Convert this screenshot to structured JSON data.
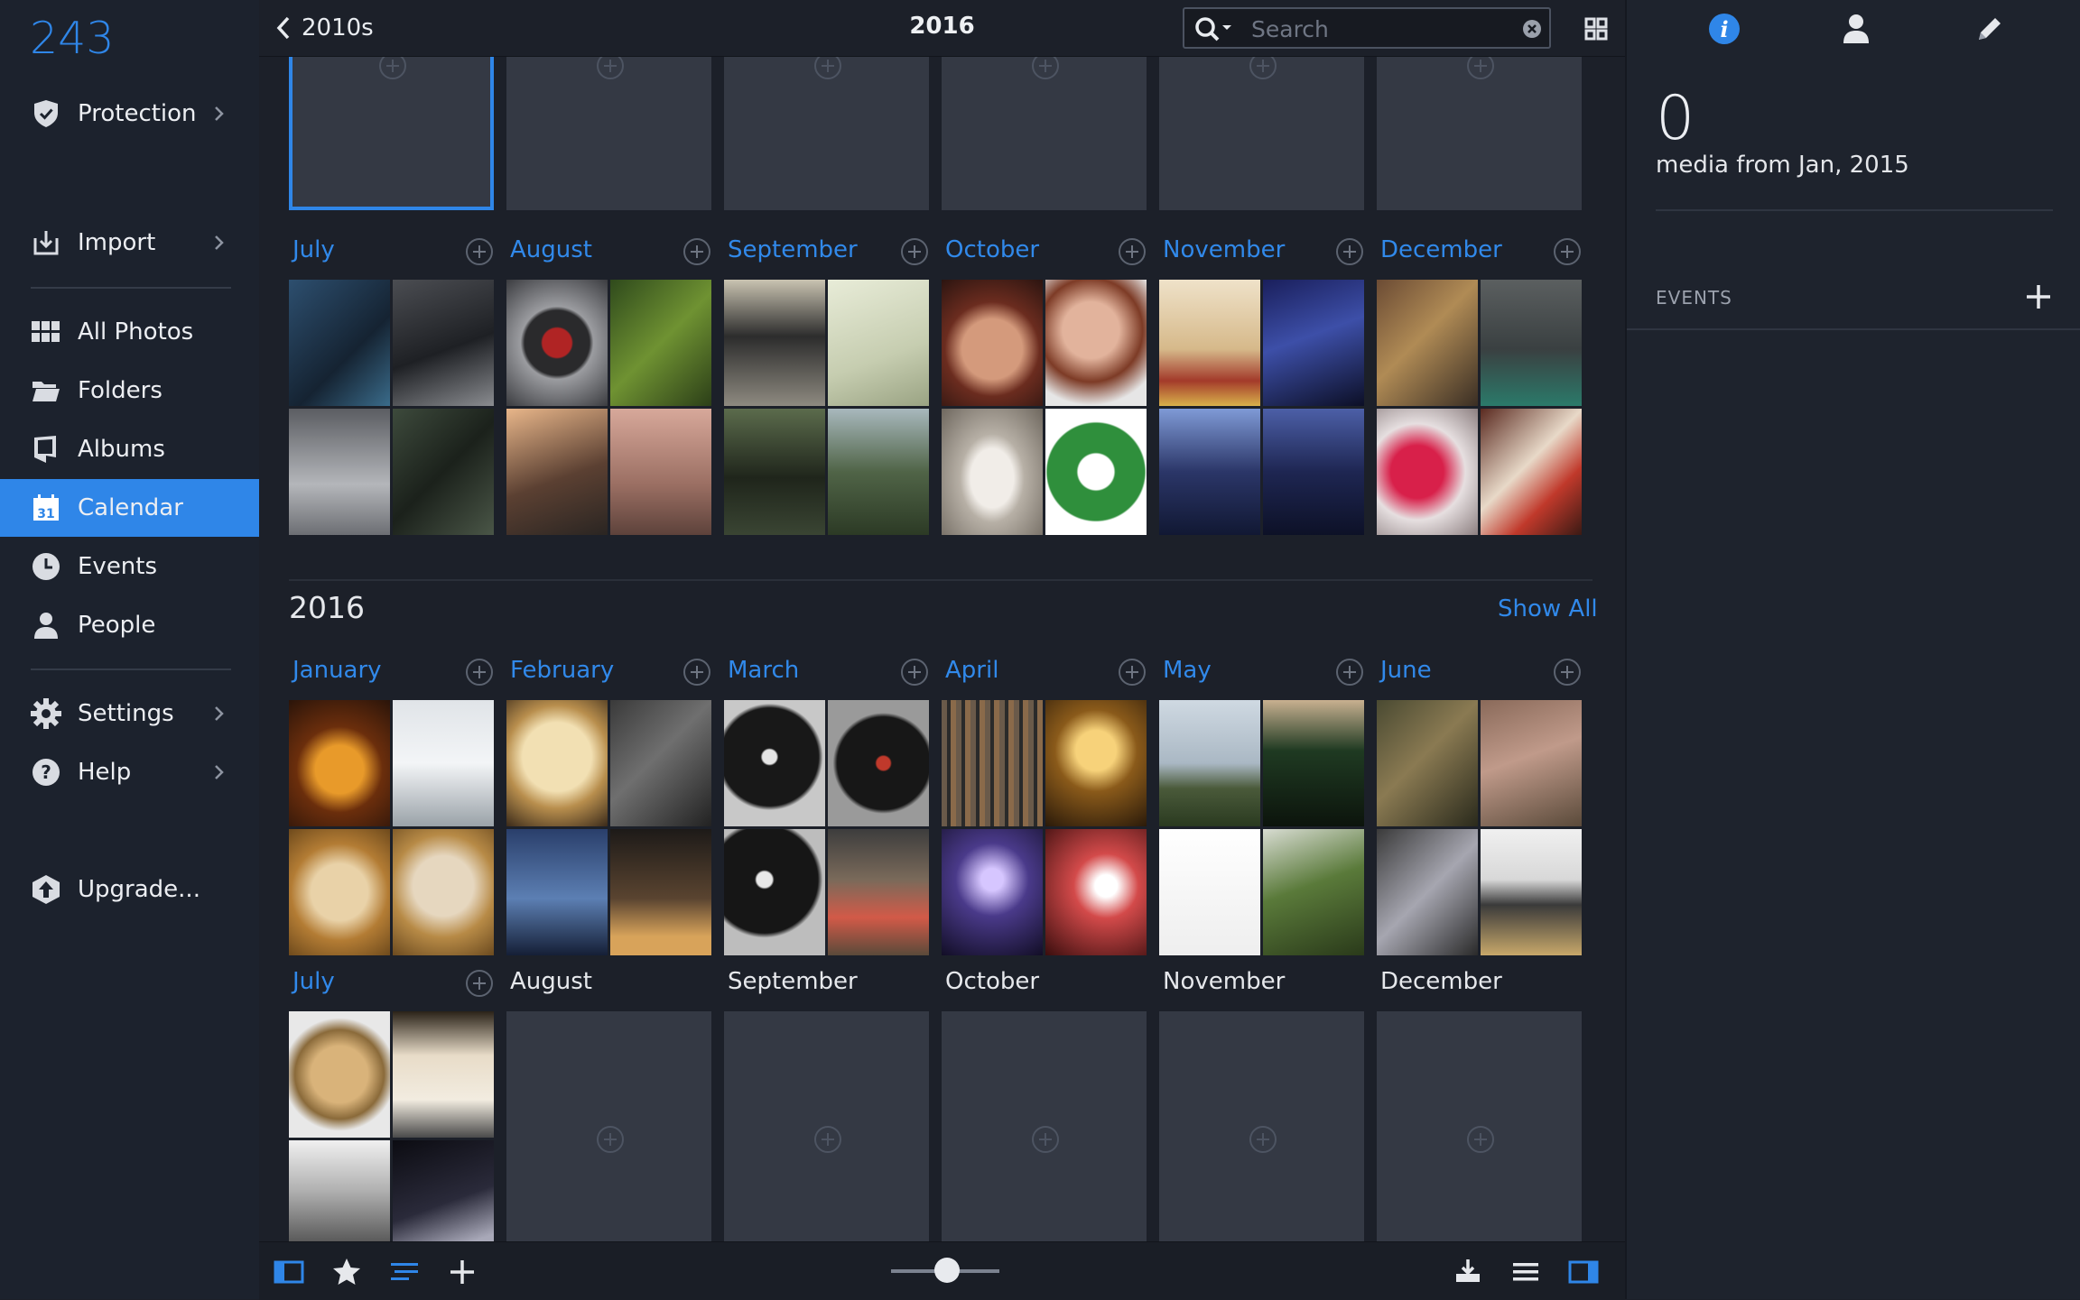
{
  "app": {
    "media_count": "243",
    "accent_color": "#2f86e8"
  },
  "sidebar": {
    "items": [
      {
        "id": "protection",
        "label": "Protection",
        "icon": "shield-check-icon",
        "chevron": true
      },
      {
        "id": "import",
        "label": "Import",
        "icon": "import-tray-icon",
        "chevron": true
      },
      {
        "id": "all-photos",
        "label": "All Photos",
        "icon": "grid-icon",
        "chevron": false
      },
      {
        "id": "folders",
        "label": "Folders",
        "icon": "folder-icon",
        "chevron": false
      },
      {
        "id": "albums",
        "label": "Albums",
        "icon": "album-icon",
        "chevron": false
      },
      {
        "id": "calendar",
        "label": "Calendar",
        "icon": "calendar-icon",
        "chevron": false,
        "active": true,
        "badge": "31"
      },
      {
        "id": "events",
        "label": "Events",
        "icon": "clock-icon",
        "chevron": false
      },
      {
        "id": "people",
        "label": "People",
        "icon": "person-icon",
        "chevron": false
      },
      {
        "id": "settings",
        "label": "Settings",
        "icon": "gear-icon",
        "chevron": true
      },
      {
        "id": "help",
        "label": "Help",
        "icon": "question-icon",
        "chevron": true
      },
      {
        "id": "upgrade",
        "label": "Upgrade...",
        "icon": "upgrade-icon",
        "chevron": false
      }
    ]
  },
  "topbar": {
    "back_label": "2010s",
    "title": "2016",
    "search_placeholder": "Search"
  },
  "calendar": {
    "year_2015_row": {
      "months": [
        "July",
        "August",
        "September",
        "October",
        "November",
        "December"
      ]
    },
    "year_2016": {
      "label": "2016",
      "show_all": "Show All",
      "row1": [
        "January",
        "February",
        "March",
        "April",
        "May",
        "June"
      ],
      "row2": [
        "July",
        "August",
        "September",
        "October",
        "November",
        "December"
      ]
    }
  },
  "info": {
    "count": "0",
    "subtitle": "media from Jan, 2015",
    "events_header": "EVENTS"
  }
}
